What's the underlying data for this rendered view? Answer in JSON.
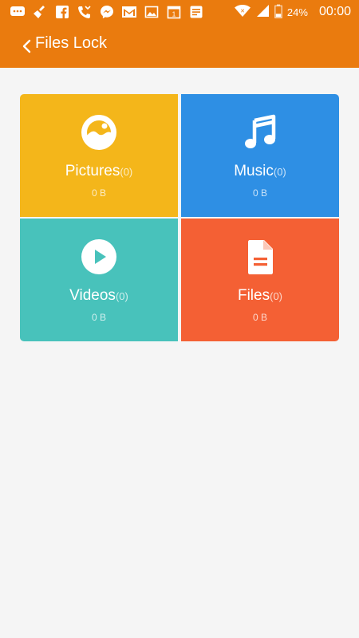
{
  "status_bar": {
    "icons": [
      "message-icon",
      "broom-icon",
      "facebook-icon",
      "missed-call-icon",
      "messenger-icon",
      "gmail-icon",
      "gallery-icon",
      "calendar-icon",
      "notes-icon",
      "wifi-icon",
      "signal-icon",
      "battery-icon"
    ],
    "calendar_day": "1",
    "battery": "24%",
    "time": "00:00"
  },
  "app_bar": {
    "title": "Files Lock",
    "back_icon": "chevron-left-icon"
  },
  "colors": {
    "app_bar": "#ea7b0e",
    "background": "#f5f5f5",
    "pictures": "#f4b61a",
    "music": "#2e8fe4",
    "videos": "#48c2bb",
    "files": "#f46034"
  },
  "tiles": [
    {
      "label": "Pictures",
      "count": "(0)",
      "size": "0 B",
      "icon": "image-icon",
      "color": "#f4b61a"
    },
    {
      "label": "Music",
      "count": "(0)",
      "size": "0 B",
      "icon": "music-note-icon",
      "color": "#2e8fe4"
    },
    {
      "label": "Videos",
      "count": "(0)",
      "size": "0 B",
      "icon": "play-icon",
      "color": "#48c2bb"
    },
    {
      "label": "Files",
      "count": "(0)",
      "size": "0 B",
      "icon": "document-icon",
      "color": "#f46034"
    }
  ]
}
